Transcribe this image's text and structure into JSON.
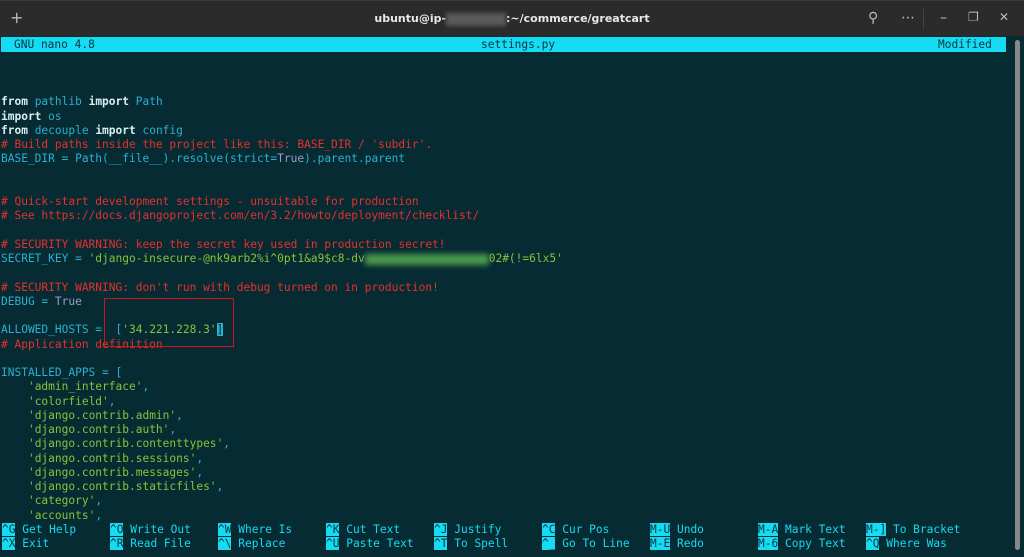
{
  "window": {
    "title_prefix": "ubuntu@ip-",
    "title_suffix": ":~/commerce/greatcart",
    "icons": [
      "plus-icon",
      "search-icon",
      "more-icon",
      "minimize-icon",
      "maximize-icon",
      "close-icon"
    ]
  },
  "nano": {
    "version": "GNU nano 4.8",
    "filename": "settings.py",
    "status": "Modified"
  },
  "highlight_color": "#d0141a",
  "lines": [
    [],
    [
      [
        "from",
        "kw"
      ],
      [
        " pathlib ",
        "id"
      ],
      [
        "import",
        "kw"
      ],
      [
        " Path",
        "id"
      ]
    ],
    [
      [
        "import",
        "kw"
      ],
      [
        " os",
        "id"
      ]
    ],
    [
      [
        "from",
        "kw"
      ],
      [
        " decouple ",
        "id"
      ],
      [
        "import",
        "kw"
      ],
      [
        " config",
        "id"
      ]
    ],
    [
      [
        "# Build paths inside the project like this: BASE_DIR / 'subdir'.",
        "cm"
      ]
    ],
    [
      [
        "BASE_DIR = Path(__file__).resolve(strict=",
        "id"
      ],
      [
        "True",
        "tr"
      ],
      [
        ").parent.parent",
        "id"
      ]
    ],
    [],
    [],
    [
      [
        "# Quick-start development settings - unsuitable for production",
        "cm"
      ]
    ],
    [
      [
        "# See https://docs.djangoproject.com/en/3.2/howto/deployment/checklist/",
        "cm"
      ]
    ],
    [],
    [
      [
        "# SECURITY WARNING: keep the secret key used in production secret!",
        "cm"
      ]
    ],
    [
      [
        "SECRET_KEY = ",
        "id"
      ],
      [
        "'django-insecure-@nk9arb2%i^0pt1&a9$c8-dv",
        "st"
      ],
      [
        "",
        "blur"
      ],
      [
        "02#(!=6lx5'",
        "st"
      ]
    ],
    [],
    [
      [
        "# SECURITY WARNING: don't run with debug turned on in production!",
        "cm"
      ]
    ],
    [
      [
        "DEBUG = ",
        "id"
      ],
      [
        "True",
        "tr"
      ]
    ],
    [],
    [
      [
        "ALLOWED_HOSTS =  [",
        "id"
      ],
      [
        "'34.221.228.3'",
        "st"
      ],
      [
        "]",
        "cursor"
      ]
    ],
    [
      [
        "# Application definition",
        "cm"
      ]
    ],
    [],
    [
      [
        "INSTALLED_APPS = [",
        "id"
      ]
    ],
    [
      [
        "    ",
        "id"
      ],
      [
        "'admin_interface'",
        "st"
      ],
      [
        ",",
        "id"
      ]
    ],
    [
      [
        "    ",
        "id"
      ],
      [
        "'colorfield'",
        "st"
      ],
      [
        ",",
        "id"
      ]
    ],
    [
      [
        "    ",
        "id"
      ],
      [
        "'django.contrib.admin'",
        "st"
      ],
      [
        ",",
        "id"
      ]
    ],
    [
      [
        "    ",
        "id"
      ],
      [
        "'django.contrib.auth'",
        "st"
      ],
      [
        ",",
        "id"
      ]
    ],
    [
      [
        "    ",
        "id"
      ],
      [
        "'django.contrib.contenttypes'",
        "st"
      ],
      [
        ",",
        "id"
      ]
    ],
    [
      [
        "    ",
        "id"
      ],
      [
        "'django.contrib.sessions'",
        "st"
      ],
      [
        ",",
        "id"
      ]
    ],
    [
      [
        "    ",
        "id"
      ],
      [
        "'django.contrib.messages'",
        "st"
      ],
      [
        ",",
        "id"
      ]
    ],
    [
      [
        "    ",
        "id"
      ],
      [
        "'django.contrib.staticfiles'",
        "st"
      ],
      [
        ",",
        "id"
      ]
    ],
    [
      [
        "    ",
        "id"
      ],
      [
        "'category'",
        "st"
      ],
      [
        ",",
        "id"
      ]
    ],
    [
      [
        "    ",
        "id"
      ],
      [
        "'accounts'",
        "st"
      ],
      [
        ",",
        "id"
      ]
    ]
  ],
  "shortcuts": [
    [
      [
        "^G",
        "Get Help"
      ],
      [
        "^X",
        "Exit"
      ]
    ],
    [
      [
        "^O",
        "Write Out"
      ],
      [
        "^R",
        "Read File"
      ]
    ],
    [
      [
        "^W",
        "Where Is"
      ],
      [
        "^\\",
        "Replace"
      ]
    ],
    [
      [
        "^K",
        "Cut Text"
      ],
      [
        "^U",
        "Paste Text"
      ]
    ],
    [
      [
        "^J",
        "Justify"
      ],
      [
        "^T",
        "To Spell"
      ]
    ],
    [
      [
        "^C",
        "Cur Pos"
      ],
      [
        "^_",
        "Go To Line"
      ]
    ],
    [
      [
        "M-U",
        "Undo"
      ],
      [
        "M-E",
        "Redo"
      ]
    ],
    [
      [
        "M-A",
        "Mark Text"
      ],
      [
        "M-6",
        "Copy Text"
      ]
    ],
    [
      [
        "M-]",
        "To Bracket"
      ],
      [
        "^Q",
        "Where Was"
      ]
    ]
  ]
}
